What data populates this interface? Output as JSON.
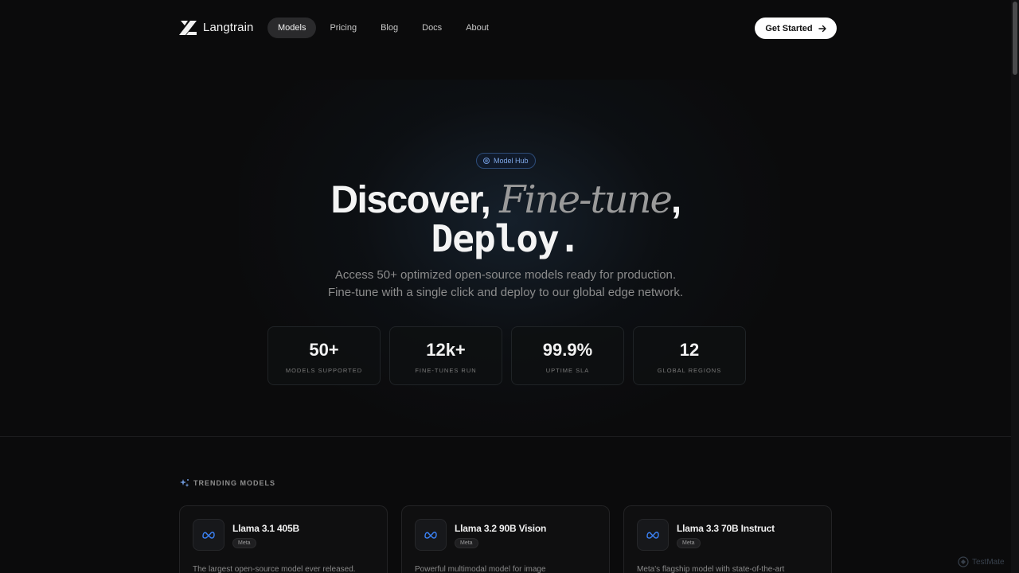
{
  "brand": {
    "name": "Langtrain"
  },
  "nav": {
    "links": [
      {
        "label": "Models",
        "active": true
      },
      {
        "label": "Pricing"
      },
      {
        "label": "Blog"
      },
      {
        "label": "Docs"
      },
      {
        "label": "About"
      }
    ],
    "cta_label": "Get Started"
  },
  "hero": {
    "badge": "Model Hub",
    "title_part1": "Discover,",
    "title_italic": "Fine-tune",
    "title_comma": ",",
    "title_line2": "Deploy.",
    "subtitle_line1": "Access 50+ optimized open-source models ready for production.",
    "subtitle_line2": "Fine-tune with a single click and deploy to our global edge network."
  },
  "stats": [
    {
      "value": "50+",
      "label": "MODELS SUPPORTED"
    },
    {
      "value": "12k+",
      "label": "FINE-TUNES RUN"
    },
    {
      "value": "99.9%",
      "label": "UPTIME SLA"
    },
    {
      "value": "12",
      "label": "GLOBAL REGIONS"
    }
  ],
  "trending": {
    "title": "TRENDING MODELS",
    "cards": [
      {
        "name": "Llama 3.1 405B",
        "tag": "Meta",
        "description": "The largest open-source model ever released."
      },
      {
        "name": "Llama 3.2 90B Vision",
        "tag": "Meta",
        "description": "Powerful multimodal model for image"
      },
      {
        "name": "Llama 3.3 70B Instruct",
        "tag": "Meta",
        "description": "Meta's flagship model with state-of-the-art"
      }
    ]
  },
  "watermark": {
    "text": "TestMate"
  },
  "colors": {
    "accent": "#6e97d8",
    "background": "#0b0b0c",
    "cta_bg": "#ffffff"
  }
}
